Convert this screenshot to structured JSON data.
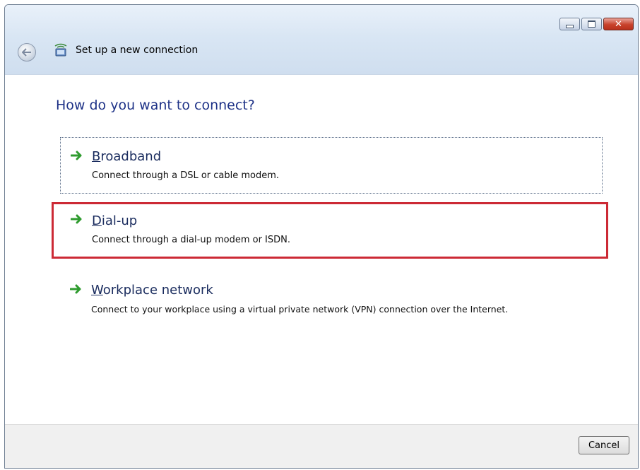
{
  "window": {
    "title": "Set up a new connection",
    "controls": {
      "minimize_icon": "minimize-icon",
      "maximize_icon": "maximize-icon",
      "close_icon": "close-icon",
      "close_glyph": "✕"
    }
  },
  "main": {
    "heading": "How do you want to connect?",
    "options": [
      {
        "key_letter": "B",
        "rest": "roadband",
        "description": "Connect through a DSL or cable modem.",
        "state": "focused"
      },
      {
        "key_letter": "D",
        "rest": "ial-up",
        "description": "Connect through a dial-up modem or ISDN.",
        "state": "highlighted"
      },
      {
        "key_letter": "W",
        "rest": "orkplace network",
        "description": "Connect to your workplace using a virtual private network (VPN) connection over the Internet.",
        "state": "normal"
      }
    ]
  },
  "footer": {
    "cancel_label": "Cancel"
  },
  "colors": {
    "heading": "#1e3287",
    "highlight_border": "#cc2a35",
    "arrow": "#2e9b2e"
  }
}
